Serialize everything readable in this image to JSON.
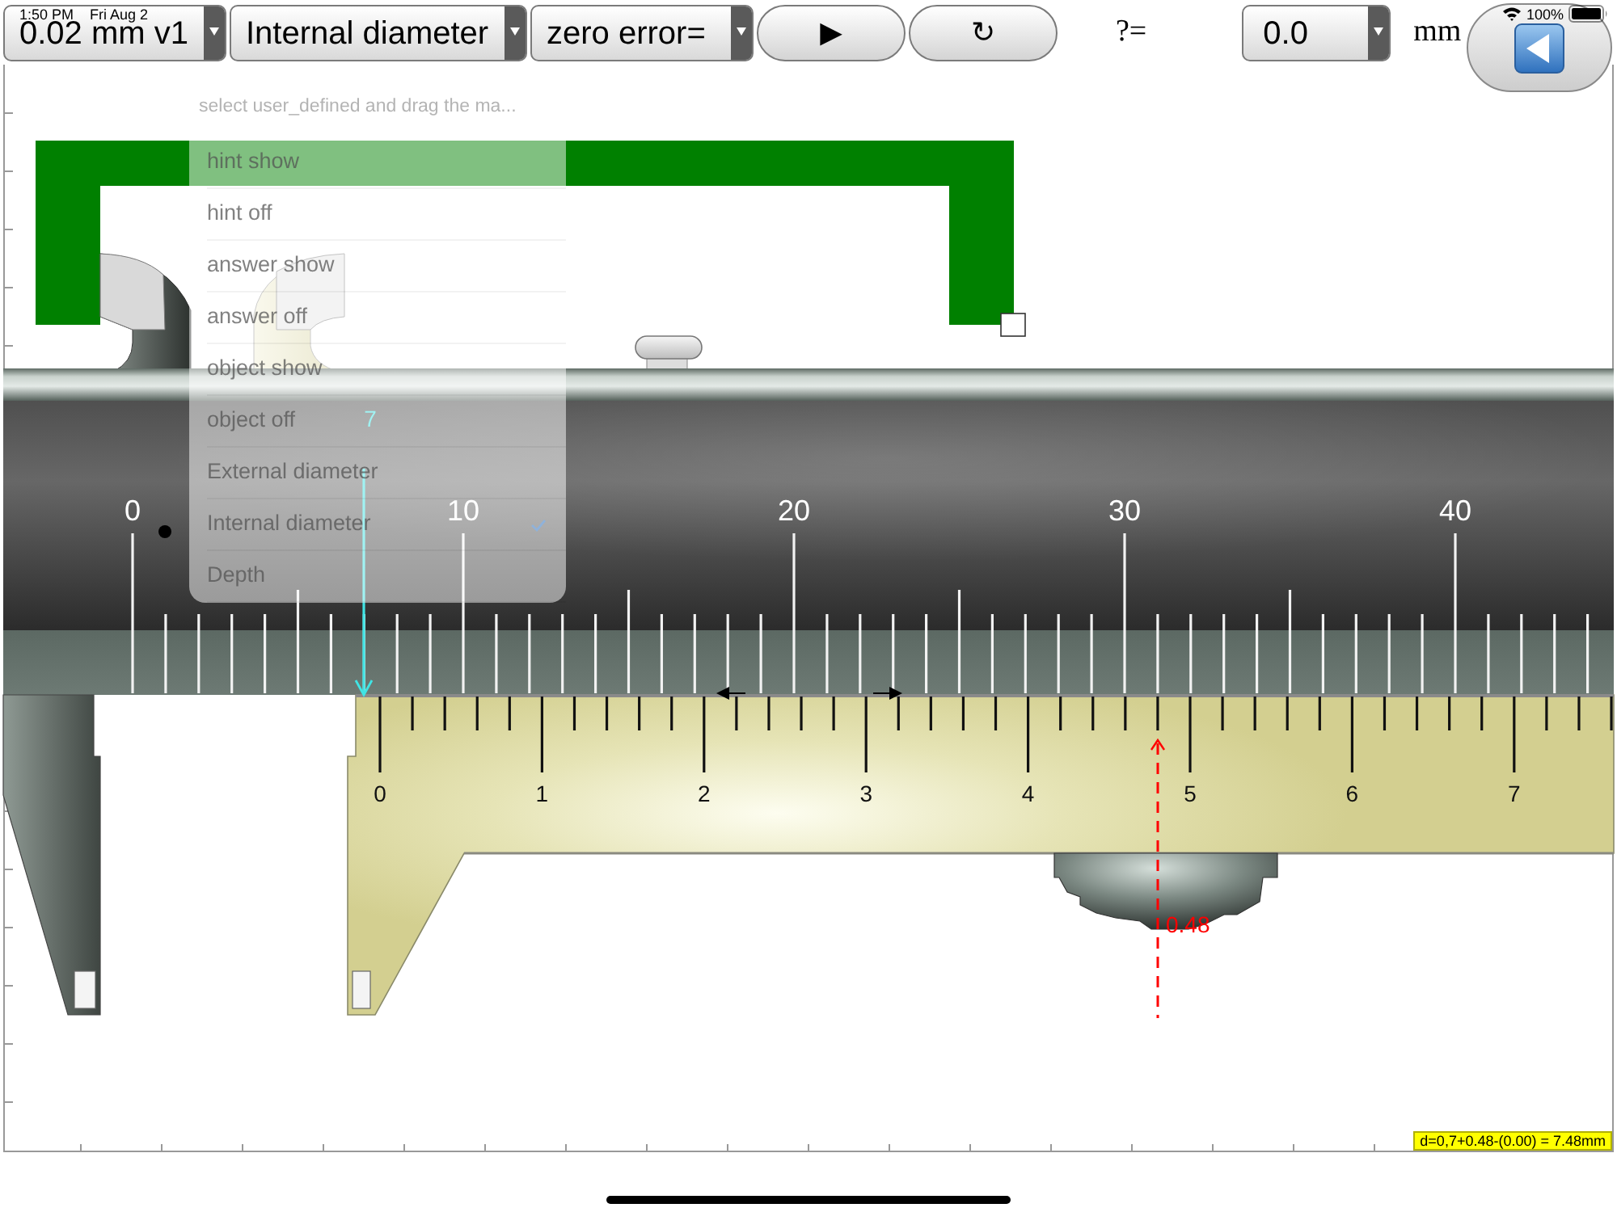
{
  "status_bar": {
    "time": "1:50 PM",
    "date": "Fri Aug 2",
    "battery": "100%"
  },
  "toolbar": {
    "selects": [
      {
        "value": "0.02 mm v1"
      },
      {
        "value": "Internal diameter"
      },
      {
        "value": "zero error="
      }
    ],
    "buttons": [
      {
        "label": "▶"
      },
      {
        "label": "↻"
      }
    ],
    "answer_label": "?=",
    "answer_select": {
      "value": "0.0"
    },
    "unit": "mm"
  },
  "menu": {
    "header": "select user_defined and drag the ma...",
    "items": [
      {
        "label": "hint show",
        "checked": false
      },
      {
        "label": "hint off",
        "checked": false
      },
      {
        "label": "answer show",
        "checked": false
      },
      {
        "label": "answer off",
        "checked": false
      },
      {
        "label": "object show",
        "checked": false
      },
      {
        "label": "object off",
        "checked": false
      },
      {
        "label": "External diameter",
        "checked": false
      },
      {
        "label": "Internal diameter",
        "checked": true
      },
      {
        "label": "Depth",
        "checked": false
      }
    ]
  },
  "caliper": {
    "main_scale_labels": [
      "0",
      "10",
      "20",
      "30",
      "40"
    ],
    "vernier_scale_labels": [
      "0",
      "1",
      "2",
      "3",
      "4",
      "5",
      "6",
      "7"
    ],
    "hint_value": "7",
    "vernier_reading": "0.48",
    "result": "d=0,7+0.48-(0.00) = 7.48mm"
  }
}
